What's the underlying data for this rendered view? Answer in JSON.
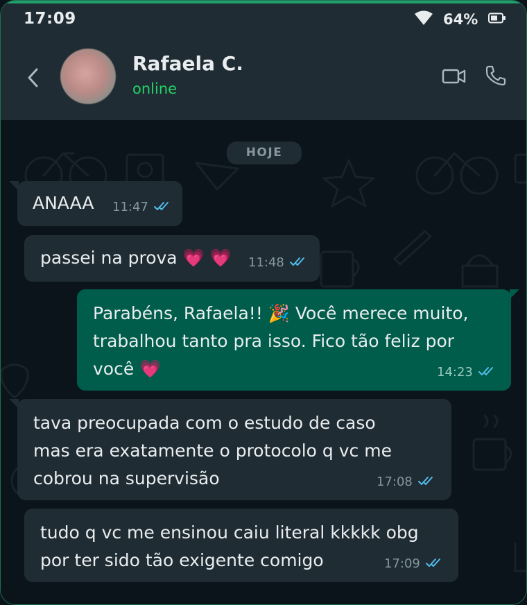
{
  "status_bar": {
    "time": "17:09",
    "battery": "64%"
  },
  "contact": {
    "name": "Rafaela C.",
    "presence": "online"
  },
  "chat": {
    "date_label": "HOJE",
    "messages": [
      {
        "direction": "incoming",
        "lines": [
          "ANAAA"
        ],
        "time": "11:47",
        "status": "read"
      },
      {
        "direction": "incoming",
        "lines": [
          "passei na prova 💗 💗"
        ],
        "time": "11:48",
        "status": "read"
      },
      {
        "direction": "outgoing",
        "lines": [
          "Parabéns, Rafaela!! 🎉 Você merece muito,",
          "trabalhou tanto pra isso. Fico tão feliz por",
          "você 💗"
        ],
        "time": "14:23",
        "status": "read"
      },
      {
        "direction": "incoming",
        "lines": [
          "tava preocupada com o estudo de caso",
          "mas era exatamente o protocolo q vc me",
          "cobrou na supervisão"
        ],
        "time": "17:08",
        "status": "read"
      },
      {
        "direction": "incoming",
        "lines": [
          "tudo q vc me ensinou caiu literal kkkkk obg",
          "por ter sido tão exigente comigo"
        ],
        "time": "17:09",
        "status": "read"
      }
    ]
  },
  "colors": {
    "accent": "#25d366",
    "outgoing_bubble": "#005c4b",
    "incoming_bubble": "#1f2c33",
    "read_ticks": "#53bdeb"
  }
}
